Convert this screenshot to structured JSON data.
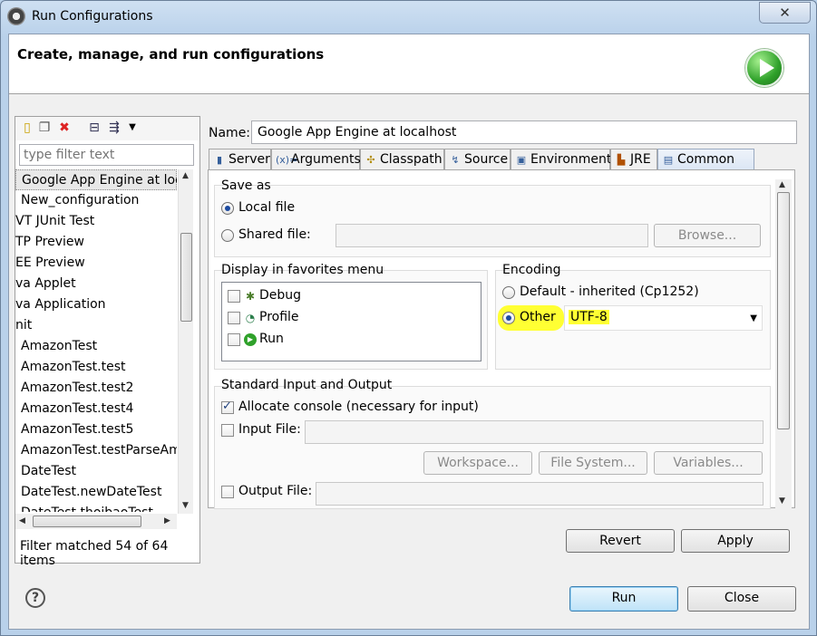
{
  "window": {
    "title": "Run Configurations",
    "close_symbol": "✕"
  },
  "banner": {
    "title": "Create, manage, and run configurations",
    "icon": "run-icon"
  },
  "left": {
    "toolbar_icons": [
      "new-config-icon",
      "duplicate-icon",
      "delete-icon",
      "collapse-all-icon",
      "filter-icon",
      "dropdown-icon"
    ],
    "filter_placeholder": "type filter text",
    "items": [
      "Google App Engine at loc",
      "New_configuration",
      "VT JUnit Test",
      "TP Preview",
      "EE Preview",
      "va Applet",
      "va Application",
      "nit",
      "AmazonTest",
      "AmazonTest.test",
      "AmazonTest.test2",
      "AmazonTest.test4",
      "AmazonTest.test5",
      "AmazonTest.testParseAma",
      "DateTest",
      "DateTest.newDateTest",
      "DateTest.thoibaoTest"
    ],
    "status": "Filter matched 54 of 64 items"
  },
  "name_label": "Name:",
  "name_value": "Google App Engine at localhost",
  "tabs": [
    "Server",
    "Arguments",
    "Classpath",
    "Source",
    "Environment",
    "JRE",
    "Common"
  ],
  "save_as": {
    "title": "Save as",
    "local_file": "Local file",
    "shared_file": "Shared file:",
    "browse": "Browse..."
  },
  "favorites": {
    "title": "Display in favorites menu",
    "items": [
      "Debug",
      "Profile",
      "Run"
    ]
  },
  "encoding": {
    "title": "Encoding",
    "default": "Default - inherited (Cp1252)",
    "other": "Other",
    "value": "UTF-8",
    "highlight_color": "#ffff33"
  },
  "std_io": {
    "title": "Standard Input and Output",
    "allocate_console": "Allocate console (necessary for input)",
    "input_file": "Input File:",
    "workspace": "Workspace...",
    "file_system": "File System...",
    "variables": "Variables...",
    "output_file": "Output File:"
  },
  "buttons": {
    "revert": "Revert",
    "apply": "Apply",
    "run": "Run",
    "close": "Close",
    "help": "?"
  }
}
